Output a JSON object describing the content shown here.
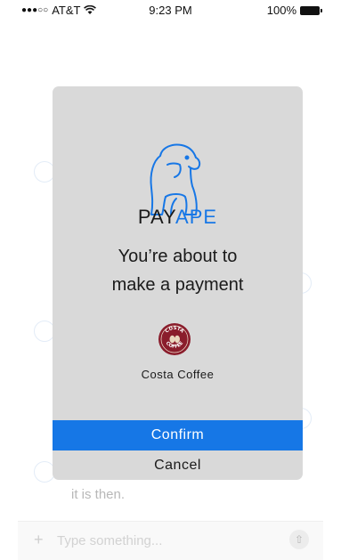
{
  "status_bar": {
    "carrier": "AT&T",
    "time": "9:23 PM",
    "battery": "100%"
  },
  "chat": {
    "partial_message": "it is then.",
    "input_placeholder": "Type something...",
    "plus_label": "+"
  },
  "modal": {
    "brand_part1": "PAY",
    "brand_part2": "APE",
    "headline_line1": "You’re about to",
    "headline_line2": "make a payment",
    "merchant_name": "Costa Coffee",
    "merchant_logo_text_top": "COSTA",
    "merchant_logo_text_bottom": "COFFEE",
    "confirm_label": "Confirm",
    "cancel_label": "Cancel"
  },
  "colors": {
    "accent": "#1677e6",
    "modal_bg": "#d9d9d9",
    "costa_red": "#8a1d2c"
  },
  "icons": {
    "signal": "signal-dots-icon",
    "wifi": "wifi-icon",
    "battery": "battery-icon",
    "brand": "gorilla-icon",
    "send": "arrow-up-icon"
  }
}
